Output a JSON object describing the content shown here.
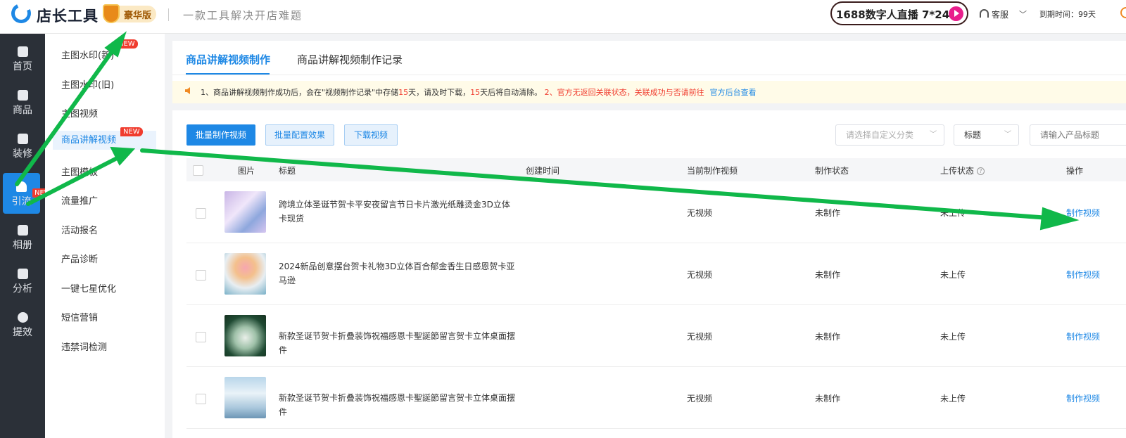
{
  "header": {
    "app_name": "店长工具",
    "edition": "豪华版",
    "slogan": "一款工具解决开店难题",
    "live_banner": "1688数字人直播 7*24h",
    "service": "客服",
    "expire": "到期时间：99天"
  },
  "leftnav": {
    "items": [
      {
        "label": "首页",
        "icon": "home-icon"
      },
      {
        "label": "商品",
        "icon": "goods-icon"
      },
      {
        "label": "装修",
        "icon": "tools-icon"
      },
      {
        "label": "引流",
        "icon": "traffic-icon"
      },
      {
        "label": "相册",
        "icon": "album-icon"
      },
      {
        "label": "分析",
        "icon": "chart-icon"
      },
      {
        "label": "提效",
        "icon": "clock-icon"
      }
    ],
    "active": "引流",
    "new_badge": "NEW"
  },
  "submenu": {
    "items": [
      {
        "label": "主图水印(新)",
        "badge": "NEW"
      },
      {
        "label": "主图水印(旧)",
        "badge": ""
      },
      {
        "label": "主图视频",
        "badge": ""
      },
      {
        "label": "商品讲解视频",
        "badge": "NEW"
      },
      {
        "label": "主图模板",
        "badge": ""
      },
      {
        "label": "流量推广",
        "badge": ""
      },
      {
        "label": "活动报名",
        "badge": ""
      },
      {
        "label": "产品诊断",
        "badge": ""
      },
      {
        "label": "一键七星优化",
        "badge": ""
      },
      {
        "label": "短信营销",
        "badge": ""
      },
      {
        "label": "违禁词检测",
        "badge": ""
      }
    ],
    "active": "商品讲解视频"
  },
  "main": {
    "tabs": [
      {
        "label": "商品讲解视频制作"
      },
      {
        "label": "商品讲解视频制作记录"
      }
    ],
    "notice": {
      "part1": "1、商品讲解视频制作成功后，会在\"视频制作记录\"中存储",
      "days1": "15",
      "part2": "天，请及时下载，",
      "days2": "15",
      "part3": "天后将自动清除。",
      "part4": "2、官方无返回关联状态，关联成功与否请前往",
      "link": "官方后台查看"
    },
    "toolbar": {
      "batch_make": "批量制作视频",
      "batch_config": "批量配置效果",
      "download": "下载视频",
      "category_placeholder": "请选择自定义分类",
      "field_select": "标题",
      "search_placeholder": "请输入产品标题"
    },
    "table": {
      "headers": [
        "图片",
        "标题",
        "创建时间",
        "当前制作视频",
        "制作状态",
        "上传状态",
        "操作"
      ],
      "rows": [
        {
          "title": "跨境立体圣诞节贺卡平安夜留言节日卡片激光纸雕烫金3D立体卡现货",
          "created": "",
          "video": "无视频",
          "status": "未制作",
          "upload": "未上传",
          "action": "制作视频"
        },
        {
          "title": "2024新品创意摆台贺卡礼物3D立体百合郁金香生日感恩贺卡亚马逊",
          "created": "",
          "video": "无视频",
          "status": "未制作",
          "upload": "未上传",
          "action": "制作视频"
        },
        {
          "title": "新款圣诞节贺卡折叠装饰祝福感恩卡聖誕節留言贺卡立体桌面摆件",
          "created": "",
          "video": "无视频",
          "status": "未制作",
          "upload": "未上传",
          "action": "制作视频"
        },
        {
          "title": "新款圣诞节贺卡折叠装饰祝福感恩卡聖誕節留言贺卡立体桌面摆件",
          "created": "",
          "video": "无视频",
          "status": "未制作",
          "upload": "未上传",
          "action": "制作视频"
        }
      ]
    }
  },
  "colors": {
    "accent": "#1e88e5",
    "nav_bg": "#2b3038",
    "badge_red": "#f03c2e",
    "annotation_arrow": "#10b84a"
  }
}
